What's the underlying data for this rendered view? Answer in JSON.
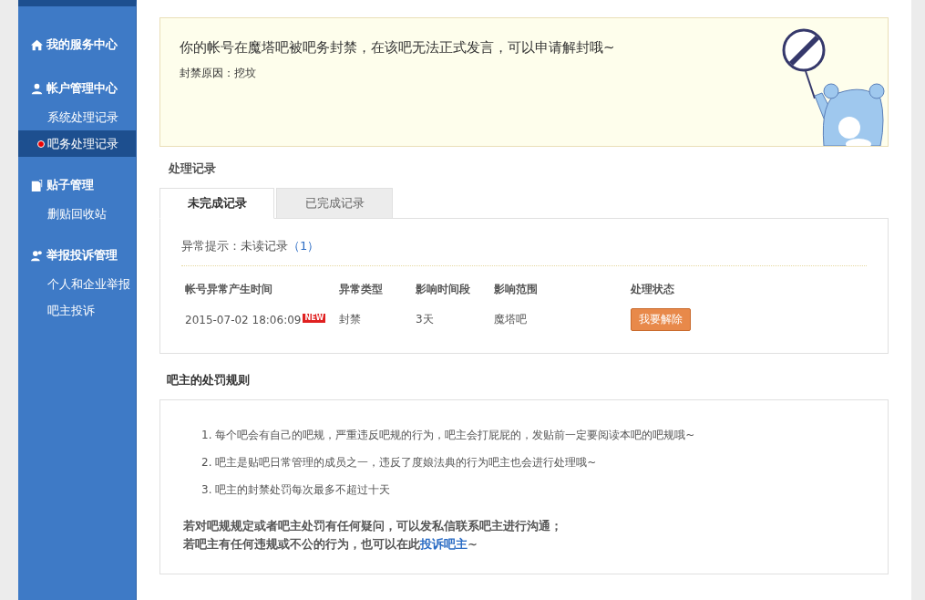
{
  "sidebar": {
    "sections": [
      {
        "title": "我的服务中心"
      },
      {
        "title": "帐户管理中心",
        "items": [
          {
            "label": "系统处理记录",
            "selected": false
          },
          {
            "label": "吧务处理记录",
            "selected": true
          }
        ]
      },
      {
        "title": "贴子管理",
        "items": [
          {
            "label": "删贴回收站",
            "selected": false
          }
        ]
      },
      {
        "title": "举报投诉管理",
        "items": [
          {
            "label": "个人和企业举报",
            "selected": false
          },
          {
            "label": "吧主投诉",
            "selected": false
          }
        ]
      }
    ]
  },
  "ban_notice": {
    "message": "你的帐号在魔塔吧被吧务封禁，在该吧无法正式发言，可以申请解封哦~",
    "reason": "封禁原因：挖坟"
  },
  "records": {
    "title": "处理记录",
    "tabs": [
      {
        "label": "未完成记录",
        "selected": true
      },
      {
        "label": "已完成记录",
        "selected": false
      }
    ],
    "alert_label": "异常提示：未读记录",
    "alert_count": "（1）",
    "columns": [
      "帐号异常产生时间",
      "异常类型",
      "影响时间段",
      "影响范围",
      "处理状态"
    ],
    "rows": [
      {
        "time": "2015-07-02 18:06:09",
        "badge": "NEW",
        "type": "封禁",
        "duration": "3天",
        "scope": "魔塔吧",
        "action": "我要解除"
      }
    ]
  },
  "rules": {
    "title": "吧主的处罚规则",
    "items": [
      "1. 每个吧会有自己的吧规，严重违反吧规的行为，吧主会打屁屁的，发贴前一定要阅读本吧的吧规哦~",
      "2. 吧主是贴吧日常管理的成员之一，违反了度娘法典的行为吧主也会进行处理哦~",
      "3. 吧主的封禁处罚每次最多不超过十天"
    ],
    "note_line1": "若对吧规规定或者吧主处罚有任何疑问，可以发私信联系吧主进行沟通；",
    "note_line2_before": "若吧主有任何违规或不公的行为，也可以在此",
    "note_link": "投诉吧主",
    "note_line2_after": "~"
  }
}
